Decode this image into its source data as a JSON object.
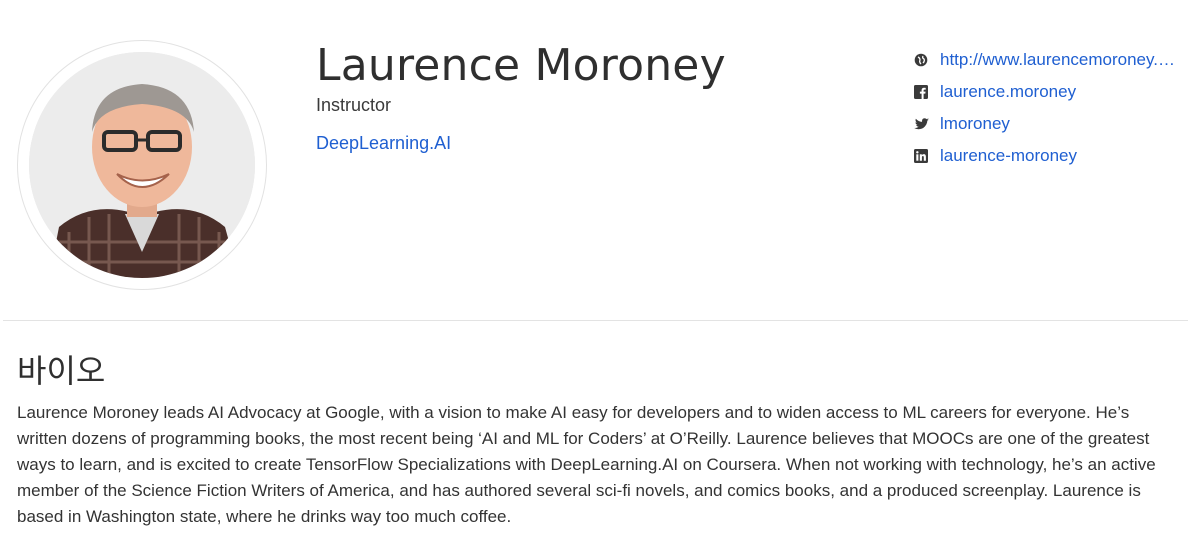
{
  "profile": {
    "name": "Laurence Moroney",
    "role": "Instructor",
    "organization": "DeepLearning.AI",
    "avatar_alt": "Laurence Moroney"
  },
  "links": [
    {
      "icon": "globe-icon",
      "text": "http://www.laurencemoroney.com"
    },
    {
      "icon": "facebook-icon",
      "text": "laurence.moroney"
    },
    {
      "icon": "twitter-icon",
      "text": "lmoroney"
    },
    {
      "icon": "linkedin-icon",
      "text": "laurence-moroney"
    }
  ],
  "bio": {
    "title": "바이오",
    "text": "Laurence Moroney leads AI Advocacy at Google, with a vision to make AI easy for developers and to widen access to ML careers for everyone. He’s written dozens of programming books, the most recent being ‘AI and ML for Coders’ at O’Reilly. Laurence believes that MOOCs are one of the greatest ways to learn, and is excited to create TensorFlow Specializations with DeepLearning.AI on Coursera. When not working with technology, he’s an active member of the Science Fiction Writers of America, and has authored several sci-fi novels, and comics books, and a produced screenplay. Laurence is based in Washington state, where he drinks way too much coffee."
  },
  "colors": {
    "link": "#1f5fd1",
    "text": "#333333",
    "icon": "#3a3a3a",
    "divider": "#e3e3e3"
  }
}
